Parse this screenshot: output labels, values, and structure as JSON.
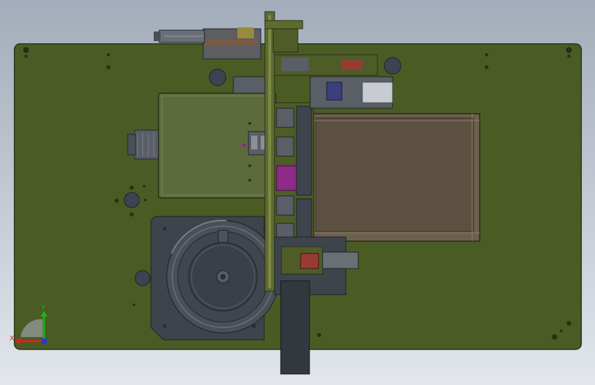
{
  "viewport": {
    "background_top": "#a3acba",
    "background_bottom": "#e2e6ec"
  },
  "model": {
    "colors": {
      "base_plate": "#4a5c24",
      "base_plate_edge": "#263012",
      "fixture_plate": "#5e6b2e",
      "dark_steel": "#3e444c",
      "hopper_box": "#5d6b3c",
      "tray": "#5c5140",
      "tray_frame": "#6b5f4d",
      "magenta_part": "#8e2a88",
      "red_part": "#9a3b33",
      "blue_part": "#3b3f7a"
    }
  },
  "triad": {
    "x_label": "X",
    "y_label": "Y",
    "x_color": "#e02020",
    "y_color": "#18b818",
    "z_color": "#1c3cd8"
  }
}
